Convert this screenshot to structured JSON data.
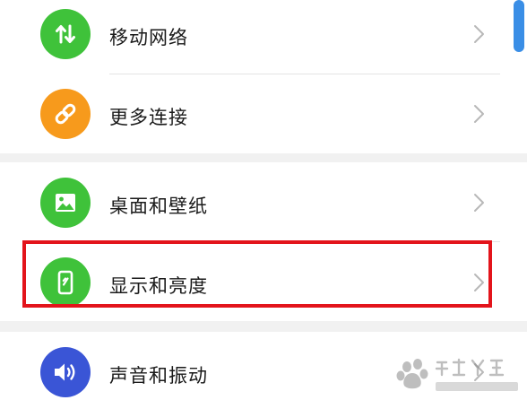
{
  "settings": {
    "items": [
      {
        "label": "移动网络",
        "icon": "mobile-data-icon",
        "icon_color": "#3fc23a"
      },
      {
        "label": "更多连接",
        "icon": "link-icon",
        "icon_color": "#f79a1c"
      },
      {
        "label": "桌面和壁纸",
        "icon": "wallpaper-icon",
        "icon_color": "#3fc23a"
      },
      {
        "label": "显示和亮度",
        "icon": "display-brightness-icon",
        "icon_color": "#3fc23a"
      },
      {
        "label": "声音和振动",
        "icon": "speaker-icon",
        "icon_color": "#3a55d6"
      }
    ]
  },
  "annotation": {
    "highlight_color": "#e3141b"
  },
  "watermark": {
    "text": "Baidu经验",
    "subtext": "jingyan.baidu.com"
  },
  "colors": {
    "scrollbar": "#3a8ee6",
    "section_gap": "#f1f1f1",
    "chevron": "#b8b8b8"
  }
}
